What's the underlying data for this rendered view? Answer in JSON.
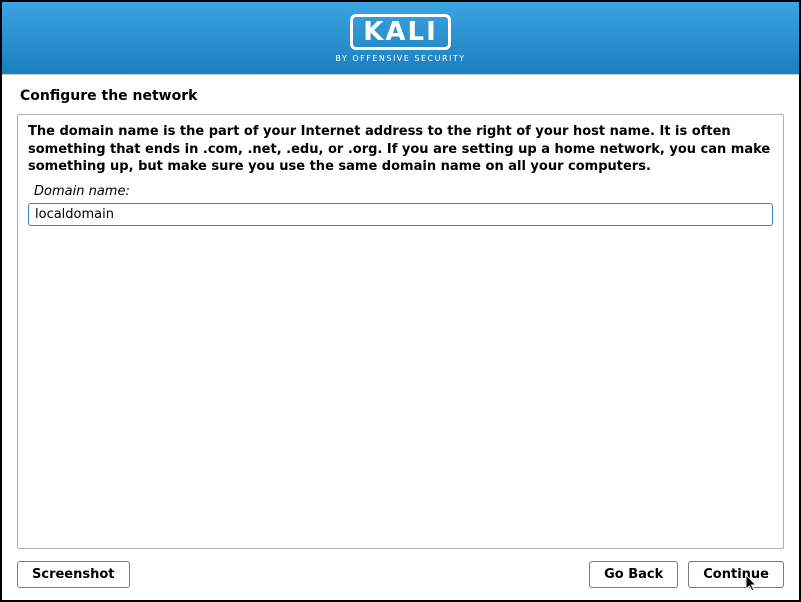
{
  "brand": {
    "name": "KALI",
    "tagline": "BY OFFENSIVE SECURITY"
  },
  "page": {
    "title": "Configure the network",
    "instruction": "The domain name is the part of your Internet address to the right of your host name.  It is often something that ends in .com, .net, .edu, or .org.  If you are setting up a home network, you can make something up, but make sure you use the same domain name on all your computers.",
    "field_label": "Domain name:",
    "field_value": "localdomain"
  },
  "buttons": {
    "screenshot": "Screenshot",
    "go_back": "Go Back",
    "continue": "Continue"
  }
}
